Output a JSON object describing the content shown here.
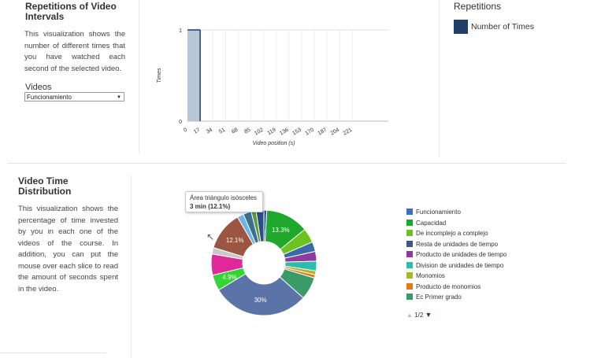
{
  "top": {
    "title": "Repetitions of Video Intervals",
    "description": "This visualization shows the number of different times that you have watched each second of the selected video.",
    "videos_label": "Videos",
    "video_select_value": "Funcionamiento",
    "legend_title": "Repetitions",
    "legend_item": "Number of Times",
    "legend_color": "#1f3f6a"
  },
  "bottom": {
    "title": "Video Time Distribution",
    "description": "This visualization shows the percentage of time invested by you in each one of the videos of the course. In addition, you can put the mouse over each slice to read the amount of seconds spent in the video.",
    "tooltip_title": "Área triángulo isósceles",
    "tooltip_value": "3 min (12.1%)",
    "pager_label": "1/2"
  },
  "chart_data": [
    {
      "type": "bar",
      "xlabel": "Video position (s)",
      "ylabel": "Times",
      "x_ticks": [
        "0",
        "17",
        "34",
        "51",
        "68",
        "85",
        "102",
        "119",
        "136",
        "153",
        "170",
        "187",
        "204",
        "221"
      ],
      "ylim": [
        0,
        1
      ],
      "y_ticks": [
        "0",
        "1"
      ],
      "series": [
        {
          "name": "Number of Times",
          "values": [
            {
              "x_start": 0,
              "x_end": 17,
              "y": 1
            }
          ],
          "color": "#b8c7d6"
        }
      ],
      "legend_position": "right"
    },
    {
      "type": "pie",
      "donut": true,
      "slices": [
        {
          "label": "",
          "value": 0.9,
          "color": "#2e5b9a"
        },
        {
          "label": "Capacidad",
          "value": 13.3,
          "color": "#1fa82b"
        },
        {
          "label": "De incomplejo a complejo",
          "value": 4.5,
          "color": "#6cc21e"
        },
        {
          "label": "Resta de unidades de tiempo",
          "value": 3.0,
          "color": "#3a6aa8"
        },
        {
          "label": "Producto de unidades de tiempo",
          "value": 3.0,
          "color": "#8e3aa0"
        },
        {
          "label": "Division de unidades de tiempo",
          "value": 3.0,
          "color": "#2bbcb0"
        },
        {
          "label": "Monomios",
          "value": 1.2,
          "color": "#a8b82a"
        },
        {
          "label": "Producto de monomios",
          "value": 1.0,
          "color": "#e07a1b"
        },
        {
          "label": "Ec Primer grado",
          "value": 7.0,
          "color": "#3a9a6a"
        },
        {
          "label": "",
          "value": 30.0,
          "color": "#5c73a8"
        },
        {
          "label": "",
          "value": 4.9,
          "color": "#33d433"
        },
        {
          "label": "",
          "value": 6.5,
          "color": "#e0289a"
        },
        {
          "label": "",
          "value": 2.0,
          "color": "#c9c9c9"
        },
        {
          "label": "Área triángulo isósceles",
          "value": 12.1,
          "color": "#9c5540"
        },
        {
          "label": "",
          "value": 2.0,
          "color": "#6db3e8"
        },
        {
          "label": "",
          "value": 2.5,
          "color": "#3a6f8f"
        },
        {
          "label": "",
          "value": 1.5,
          "color": "#5f9a3a"
        },
        {
          "label": "",
          "value": 2.4,
          "color": "#2a4f8a"
        }
      ],
      "data_labels": [
        "13.3%",
        "4.9%",
        "12.1%",
        "30%"
      ],
      "legend": [
        {
          "label": "Funcionamiento",
          "color": "#3a6fc4"
        },
        {
          "label": "Capacidad",
          "color": "#1fa82b"
        },
        {
          "label": "De incomplejo a complejo",
          "color": "#6cc21e"
        },
        {
          "label": "Resta de unidades de tiempo",
          "color": "#3a5a8a"
        },
        {
          "label": "Producto de unidades de tiempo",
          "color": "#8e3aa0"
        },
        {
          "label": "Division de unidades de tiempo",
          "color": "#2bbcb0"
        },
        {
          "label": "Monomios",
          "color": "#a8b82a"
        },
        {
          "label": "Producto de monomios",
          "color": "#e07a1b"
        },
        {
          "label": "Ec Primer grado",
          "color": "#3a9a6a"
        }
      ],
      "legend_position": "right"
    }
  ]
}
